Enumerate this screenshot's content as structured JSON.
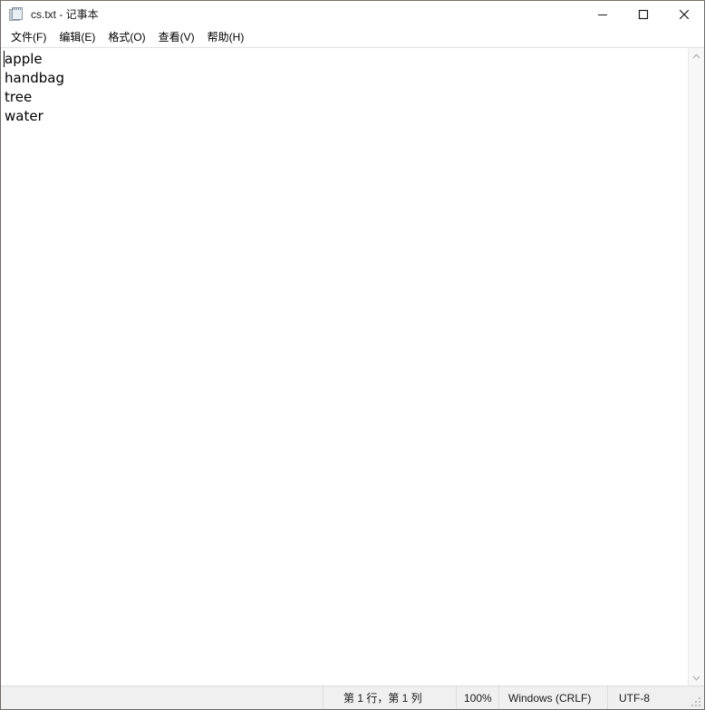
{
  "window": {
    "title": "cs.txt - 记事本",
    "icon": "notepad-icon",
    "controls": {
      "minimize_label": "最小化",
      "maximize_label": "最大化",
      "close_label": "关闭"
    }
  },
  "menubar": {
    "items": [
      {
        "label": "文件(F)",
        "name": "menu-file"
      },
      {
        "label": "编辑(E)",
        "name": "menu-edit"
      },
      {
        "label": "格式(O)",
        "name": "menu-format"
      },
      {
        "label": "查看(V)",
        "name": "menu-view"
      },
      {
        "label": "帮助(H)",
        "name": "menu-help"
      }
    ]
  },
  "editor": {
    "content": "apple\nhandbag\ntree\nwater",
    "lines": [
      "apple",
      "handbag",
      "tree",
      "water"
    ],
    "caret_line": 1,
    "caret_column": 1
  },
  "scrollbar": {
    "up_arrow_icon": "chevron-up-icon",
    "down_arrow_icon": "chevron-down-icon"
  },
  "statusbar": {
    "line_col": "第 1 行，第 1 列",
    "zoom": "100%",
    "line_ending": "Windows (CRLF)",
    "encoding": "UTF-8"
  },
  "colors": {
    "window_background": "#ffffff",
    "statusbar_background": "#f0f0f0",
    "scrollbar_background": "#f7f7f7",
    "border": "#6d6a66",
    "text": "#000000"
  }
}
